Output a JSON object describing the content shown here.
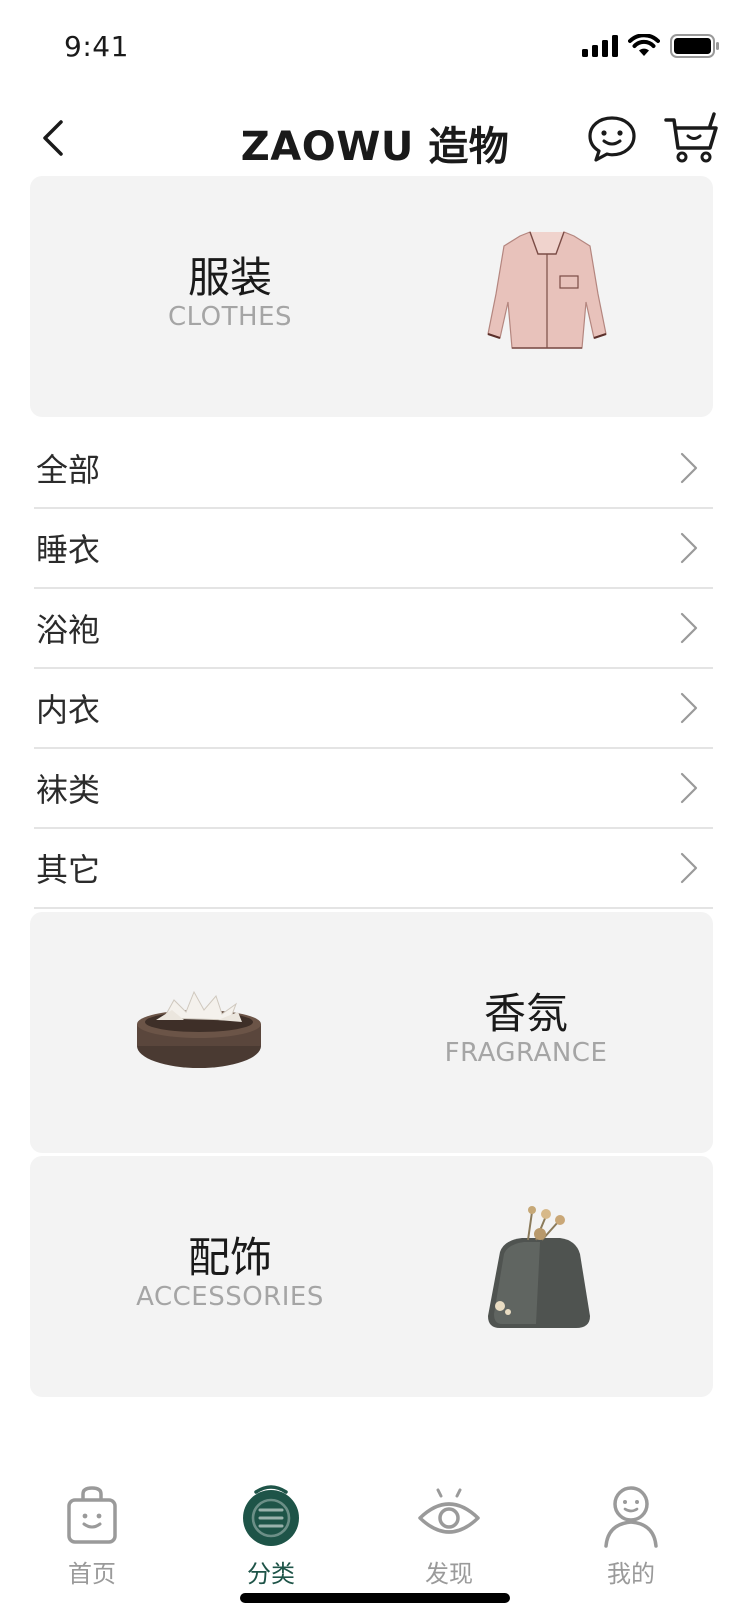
{
  "status_bar": {
    "time": "9:41"
  },
  "nav": {
    "title": "ZAOWU 造物"
  },
  "cards": [
    {
      "title": "服装",
      "subtitle": "CLOTHES"
    },
    {
      "title": "香氛",
      "subtitle": "FRAGRANCE"
    },
    {
      "title": "配饰",
      "subtitle": "ACCESSORIES"
    }
  ],
  "sub_categories": [
    {
      "label": "全部"
    },
    {
      "label": "睡衣"
    },
    {
      "label": "浴袍"
    },
    {
      "label": "内衣"
    },
    {
      "label": "袜类"
    },
    {
      "label": "其它"
    }
  ],
  "tabs": [
    {
      "label": "首页",
      "icon": "shopping-bag-icon",
      "active": false
    },
    {
      "label": "分类",
      "icon": "category-icon",
      "active": true
    },
    {
      "label": "发现",
      "icon": "eye-icon",
      "active": false
    },
    {
      "label": "我的",
      "icon": "user-icon",
      "active": false
    }
  ],
  "colors": {
    "accent": "#1e5448",
    "card_bg": "#f3f3f3",
    "inactive": "#9a9a9a"
  }
}
